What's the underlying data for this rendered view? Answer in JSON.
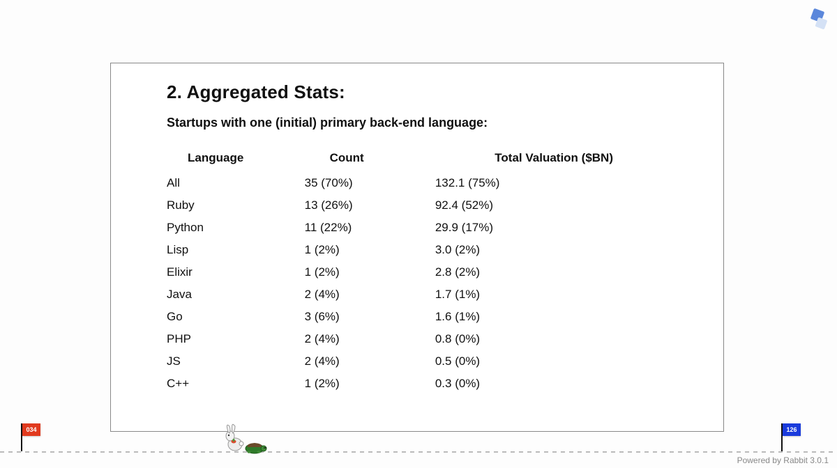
{
  "slide": {
    "title": "2. Aggregated Stats:",
    "subtitle": "Startups with one (initial) primary back-end language:"
  },
  "table": {
    "headers": {
      "language": "Language",
      "count": "Count",
      "valuation": "Total Valuation ($BN)"
    },
    "rows": [
      {
        "language": "All",
        "count": "35 (70%)",
        "valuation": "132.1 (75%)"
      },
      {
        "language": "Ruby",
        "count": "13 (26%)",
        "valuation": "92.4 (52%)"
      },
      {
        "language": "Python",
        "count": "11 (22%)",
        "valuation": "29.9 (17%)"
      },
      {
        "language": "Lisp",
        "count": "1 (2%)",
        "valuation": "3.0 (2%)"
      },
      {
        "language": "Elixir",
        "count": "1 (2%)",
        "valuation": "2.8 (2%)"
      },
      {
        "language": "Java",
        "count": "2 (4%)",
        "valuation": "1.7 (1%)"
      },
      {
        "language": "Go",
        "count": "3 (6%)",
        "valuation": "1.6 (1%)"
      },
      {
        "language": "PHP",
        "count": "2 (4%)",
        "valuation": "0.8 (0%)"
      },
      {
        "language": "JS",
        "count": "2 (4%)",
        "valuation": "0.5 (0%)"
      },
      {
        "language": "C++",
        "count": "1 (2%)",
        "valuation": "0.3 (0%)"
      }
    ]
  },
  "progress": {
    "current_slide": "034",
    "total_slides": "126"
  },
  "footer": {
    "powered_by": "Powered by Rabbit 3.0.1"
  },
  "chart_data": {
    "type": "table",
    "title": "Startups with one (initial) primary back-end language",
    "columns": [
      "Language",
      "Count",
      "Count %",
      "Total Valuation ($BN)",
      "Valuation %"
    ],
    "rows": [
      [
        "All",
        35,
        70,
        132.1,
        75
      ],
      [
        "Ruby",
        13,
        26,
        92.4,
        52
      ],
      [
        "Python",
        11,
        22,
        29.9,
        17
      ],
      [
        "Lisp",
        1,
        2,
        3.0,
        2
      ],
      [
        "Elixir",
        1,
        2,
        2.8,
        2
      ],
      [
        "Java",
        2,
        4,
        1.7,
        1
      ],
      [
        "Go",
        3,
        6,
        1.6,
        1
      ],
      [
        "PHP",
        2,
        4,
        0.8,
        0
      ],
      [
        "JS",
        2,
        4,
        0.5,
        0
      ],
      [
        "C++",
        1,
        2,
        0.3,
        0
      ]
    ]
  }
}
